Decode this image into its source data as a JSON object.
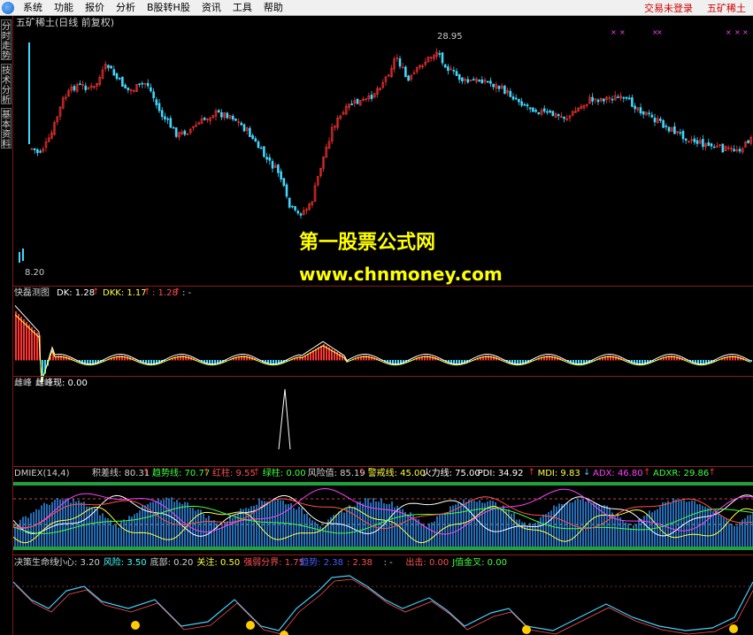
{
  "menu": {
    "items": [
      "系统",
      "功能",
      "报价",
      "分析",
      "B股转H股",
      "资讯",
      "工具",
      "帮助"
    ],
    "right": [
      "交易未登录",
      "五矿稀土"
    ]
  },
  "sidebar": {
    "tabs": [
      "分时走势",
      "技术分析",
      "基本资料"
    ]
  },
  "main_chart": {
    "title": "五矿稀土(日线 前复权)",
    "high_label": "28.95",
    "low_label": "8.20"
  },
  "watermark": {
    "line1": "第一股票公式网",
    "line2": "www.chnmoney.com"
  },
  "panel1": {
    "name": "快磊测图",
    "dk": "DK: 1.28",
    "dkk": "DKK: 1.17",
    "v3": ": 1.28",
    "v4": ": -"
  },
  "panel2": {
    "name": "雌峰",
    "value": "雌峰现: 0.00"
  },
  "panel3": {
    "name": "DMIEX(14,4)",
    "items": [
      {
        "label": "积差线: 80.31",
        "color": "#d0d0d0",
        "arrow": "up"
      },
      {
        "label": "趋势线: 70.77",
        "color": "#40ff40",
        "arrow": "up"
      },
      {
        "label": "红柱: 9.55",
        "color": "#ff5050",
        "arrow": "up"
      },
      {
        "label": "绿柱: 0.00",
        "color": "#40ff40",
        "arrow": ""
      },
      {
        "label": "风险值: 85.19",
        "color": "#d0d0d0",
        "arrow": "up"
      },
      {
        "label": "警戒线: 45.00",
        "color": "#ffff40",
        "arrow": ""
      },
      {
        "label": "火力线: 75.00",
        "color": "#ffffff",
        "arrow": ""
      },
      {
        "label": "PDI: 34.92",
        "color": "#ffffff",
        "arrow": "up"
      },
      {
        "label": "MDI: 9.83",
        "color": "#ffff40",
        "arrow": "down"
      },
      {
        "label": "ADX: 46.80",
        "color": "#ff40ff",
        "arrow": "up"
      },
      {
        "label": "ADXR: 29.86",
        "color": "#40ff40",
        "arrow": "up"
      }
    ]
  },
  "panel4": {
    "name": "决策生命线",
    "items": [
      {
        "label": "小心: 3.20",
        "color": "#d0d0d0"
      },
      {
        "label": "风险: 3.50",
        "color": "#40ffff"
      },
      {
        "label": "底部: 0.20",
        "color": "#d0d0d0"
      },
      {
        "label": "关注: 0.50",
        "color": "#ffff40"
      },
      {
        "label": "强弱分界: 1.75",
        "color": "#ff5050"
      },
      {
        "label": "趋势: 2.38",
        "color": "#4060ff"
      },
      {
        "label": ": 2.38",
        "color": "#ff5050"
      },
      {
        "label": ": -",
        "color": "#d0d0d0"
      },
      {
        "label": "出击: 0.00",
        "color": "#ff5050"
      },
      {
        "label": "J值金叉: 0.00",
        "color": "#40ff40"
      }
    ]
  },
  "colors": {
    "up": "#ff3333",
    "down": "#40d8ff",
    "divider": "#8b1a1a",
    "watermark": "#ffff00"
  }
}
